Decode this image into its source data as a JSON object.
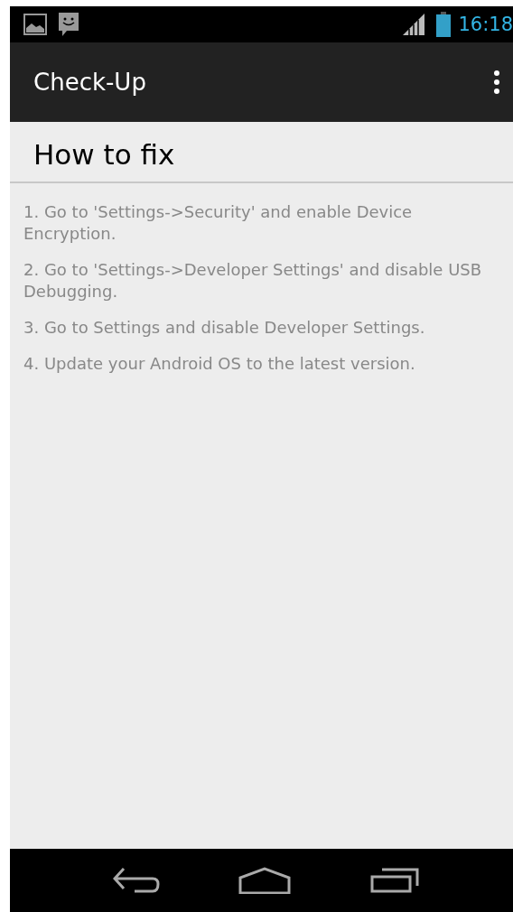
{
  "status_bar": {
    "time": "16:18"
  },
  "action_bar": {
    "title": "Check-Up"
  },
  "heading": "How to fix",
  "steps": [
    "1. Go to 'Settings->Security' and enable Device Encryption.",
    "2. Go to 'Settings->Developer Settings' and disable USB Debugging.",
    "3. Go to Settings and disable Developer Settings.",
    "4. Update your Android OS to the latest version."
  ]
}
